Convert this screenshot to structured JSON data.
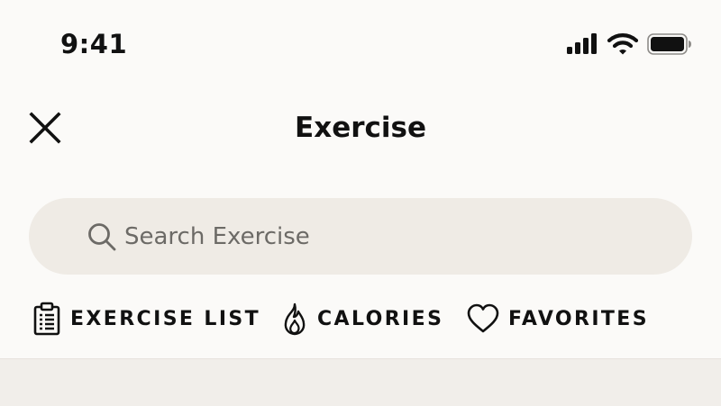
{
  "status_bar": {
    "time": "9:41",
    "icons": [
      "signal-icon",
      "wifi-icon",
      "battery-icon"
    ]
  },
  "nav": {
    "title": "Exercise",
    "close_icon": "close-icon"
  },
  "search": {
    "placeholder": "Search Exercise",
    "value": "",
    "icon": "search-icon"
  },
  "tabs": [
    {
      "label": "EXERCISE LIST",
      "icon": "clipboard-icon"
    },
    {
      "label": "CALORIES",
      "icon": "flame-icon"
    },
    {
      "label": "FAVORITES",
      "icon": "heart-icon"
    }
  ],
  "colors": {
    "background": "#FBFAF8",
    "search_background": "#EFEBE5",
    "content_background": "#F1EEEA",
    "text": "#111111",
    "placeholder": "#6C6A66"
  }
}
